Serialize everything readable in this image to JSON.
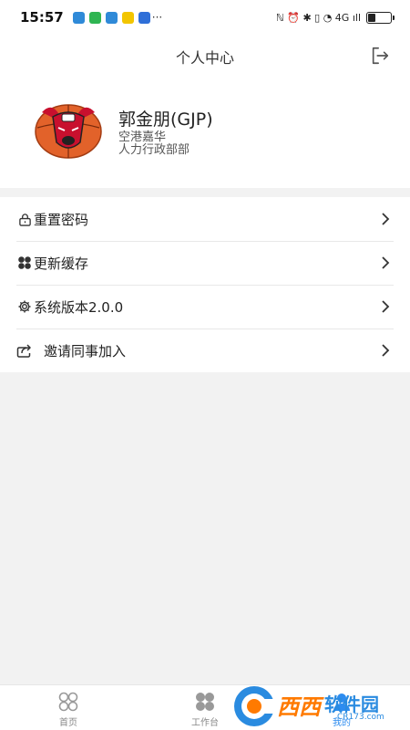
{
  "status_bar": {
    "time": "15:57",
    "right_text": "ℕ ⏰ ✱ ▯ ◔ 4G ıll",
    "battery_level": 0.35,
    "app_icon_colors": [
      "#2f8ad8",
      "#2fb552",
      "#2f8ad8",
      "#f2c500",
      "#2f6fd8"
    ],
    "more": "···"
  },
  "header": {
    "title": "个人中心",
    "logout_icon": "logout-icon"
  },
  "profile": {
    "name": "郭金朋(GJP)",
    "company": "空港嘉华",
    "department": "人力行政部部",
    "avatar": "bulls-logo-avatar"
  },
  "menu": {
    "items": [
      {
        "label": "重置密码",
        "icon": "lock-icon"
      },
      {
        "label": "更新缓存",
        "icon": "clover-icon"
      },
      {
        "label": "系统版本2.0.0",
        "icon": "gear-icon"
      },
      {
        "label": "邀请同事加入",
        "icon": "share-icon"
      }
    ]
  },
  "tab_bar": {
    "tabs": [
      {
        "label": "首页",
        "icon": "home-grid-icon",
        "active": false
      },
      {
        "label": "工作台",
        "icon": "workbench-icon",
        "active": false
      },
      {
        "label": "我的",
        "icon": "profile-icon",
        "active": true
      }
    ]
  },
  "watermark": {
    "text_main": "西西",
    "text_secondary": "软件园",
    "domain": "CR173.com"
  },
  "colors": {
    "accent": "#2d8cf0",
    "background": "#f2f2f2",
    "surface": "#ffffff"
  }
}
